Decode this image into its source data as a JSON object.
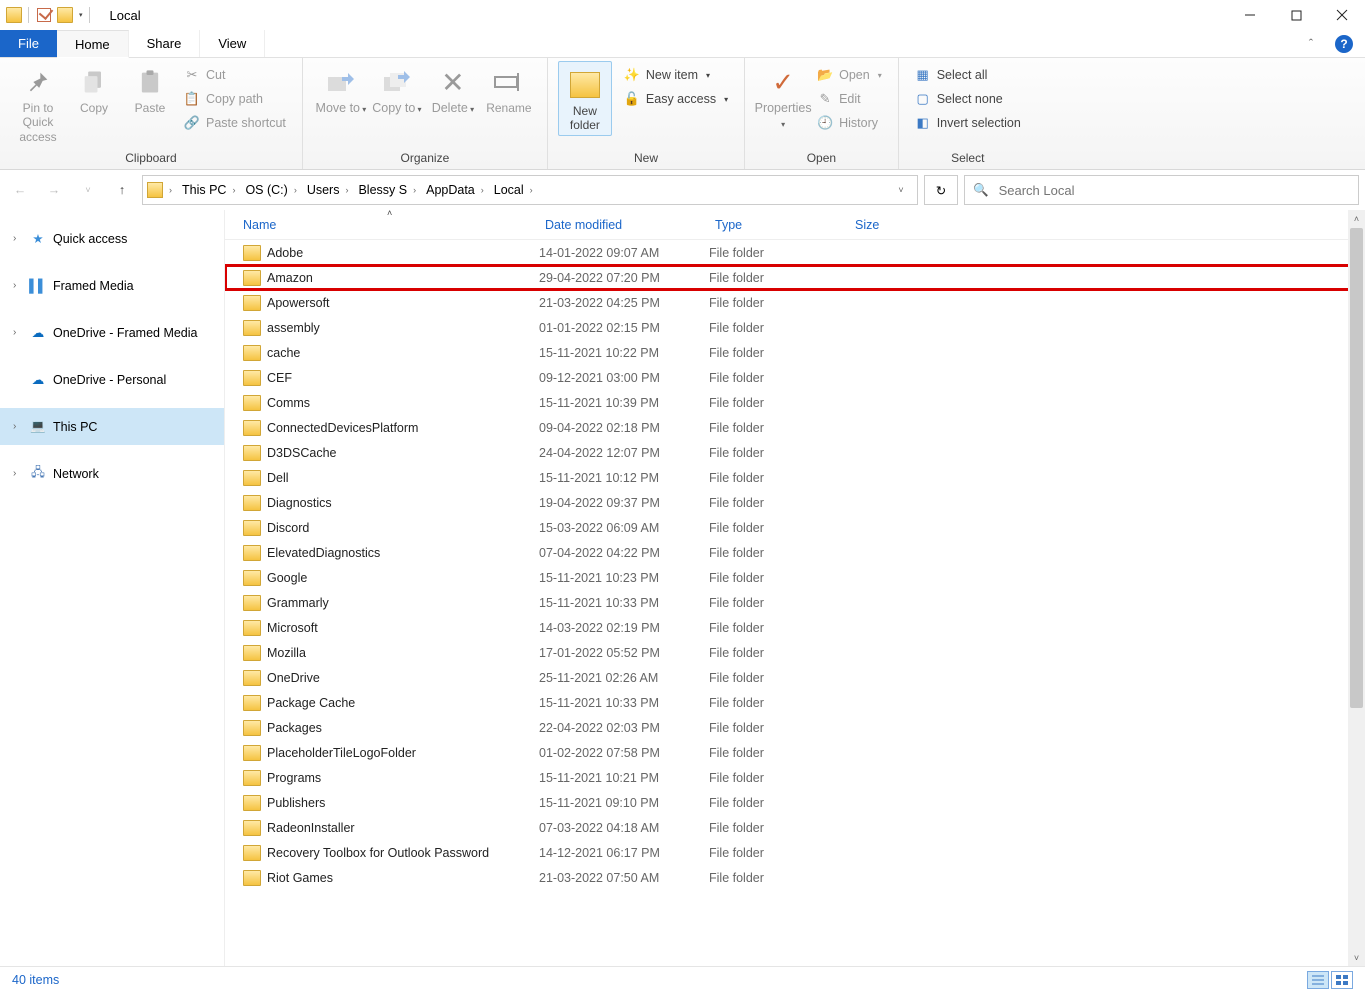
{
  "title": "Local",
  "tabs": {
    "file": "File",
    "home": "Home",
    "share": "Share",
    "view": "View"
  },
  "ribbon": {
    "clipboard": {
      "label": "Clipboard",
      "pin": "Pin to Quick access",
      "copy": "Copy",
      "paste": "Paste",
      "cut": "Cut",
      "copypath": "Copy path",
      "pasteshort": "Paste shortcut"
    },
    "organize": {
      "label": "Organize",
      "moveto": "Move to",
      "copyto": "Copy to",
      "delete": "Delete",
      "rename": "Rename"
    },
    "new": {
      "label": "New",
      "newfolder": "New folder",
      "newitem": "New item",
      "easyaccess": "Easy access"
    },
    "open": {
      "label": "Open",
      "properties": "Properties",
      "open": "Open",
      "edit": "Edit",
      "history": "History"
    },
    "select": {
      "label": "Select",
      "selectall": "Select all",
      "selectnone": "Select none",
      "invert": "Invert selection"
    }
  },
  "breadcrumb": [
    "This PC",
    "OS (C:)",
    "Users",
    "Blessy S",
    "AppData",
    "Local"
  ],
  "search_placeholder": "Search Local",
  "navpane": {
    "quick": "Quick access",
    "framed": "Framed Media",
    "onedrive_framed": "OneDrive - Framed Media",
    "onedrive_personal": "OneDrive - Personal",
    "thispc": "This PC",
    "network": "Network"
  },
  "columns": {
    "name": "Name",
    "date": "Date modified",
    "type": "Type",
    "size": "Size"
  },
  "rows": [
    {
      "name": "Adobe",
      "date": "14-01-2022 09:07 AM",
      "type": "File folder",
      "hl": false
    },
    {
      "name": "Amazon",
      "date": "29-04-2022 07:20 PM",
      "type": "File folder",
      "hl": true
    },
    {
      "name": "Apowersoft",
      "date": "21-03-2022 04:25 PM",
      "type": "File folder",
      "hl": false
    },
    {
      "name": "assembly",
      "date": "01-01-2022 02:15 PM",
      "type": "File folder",
      "hl": false
    },
    {
      "name": "cache",
      "date": "15-11-2021 10:22 PM",
      "type": "File folder",
      "hl": false
    },
    {
      "name": "CEF",
      "date": "09-12-2021 03:00 PM",
      "type": "File folder",
      "hl": false
    },
    {
      "name": "Comms",
      "date": "15-11-2021 10:39 PM",
      "type": "File folder",
      "hl": false
    },
    {
      "name": "ConnectedDevicesPlatform",
      "date": "09-04-2022 02:18 PM",
      "type": "File folder",
      "hl": false
    },
    {
      "name": "D3DSCache",
      "date": "24-04-2022 12:07 PM",
      "type": "File folder",
      "hl": false
    },
    {
      "name": "Dell",
      "date": "15-11-2021 10:12 PM",
      "type": "File folder",
      "hl": false
    },
    {
      "name": "Diagnostics",
      "date": "19-04-2022 09:37 PM",
      "type": "File folder",
      "hl": false
    },
    {
      "name": "Discord",
      "date": "15-03-2022 06:09 AM",
      "type": "File folder",
      "hl": false
    },
    {
      "name": "ElevatedDiagnostics",
      "date": "07-04-2022 04:22 PM",
      "type": "File folder",
      "hl": false
    },
    {
      "name": "Google",
      "date": "15-11-2021 10:23 PM",
      "type": "File folder",
      "hl": false
    },
    {
      "name": "Grammarly",
      "date": "15-11-2021 10:33 PM",
      "type": "File folder",
      "hl": false
    },
    {
      "name": "Microsoft",
      "date": "14-03-2022 02:19 PM",
      "type": "File folder",
      "hl": false
    },
    {
      "name": "Mozilla",
      "date": "17-01-2022 05:52 PM",
      "type": "File folder",
      "hl": false
    },
    {
      "name": "OneDrive",
      "date": "25-11-2021 02:26 AM",
      "type": "File folder",
      "hl": false
    },
    {
      "name": "Package Cache",
      "date": "15-11-2021 10:33 PM",
      "type": "File folder",
      "hl": false
    },
    {
      "name": "Packages",
      "date": "22-04-2022 02:03 PM",
      "type": "File folder",
      "hl": false
    },
    {
      "name": "PlaceholderTileLogoFolder",
      "date": "01-02-2022 07:58 PM",
      "type": "File folder",
      "hl": false
    },
    {
      "name": "Programs",
      "date": "15-11-2021 10:21 PM",
      "type": "File folder",
      "hl": false
    },
    {
      "name": "Publishers",
      "date": "15-11-2021 09:10 PM",
      "type": "File folder",
      "hl": false
    },
    {
      "name": "RadeonInstaller",
      "date": "07-03-2022 04:18 AM",
      "type": "File folder",
      "hl": false
    },
    {
      "name": "Recovery Toolbox for Outlook Password",
      "date": "14-12-2021 06:17 PM",
      "type": "File folder",
      "hl": false
    },
    {
      "name": "Riot Games",
      "date": "21-03-2022 07:50 AM",
      "type": "File folder",
      "hl": false
    }
  ],
  "status": "40 items"
}
